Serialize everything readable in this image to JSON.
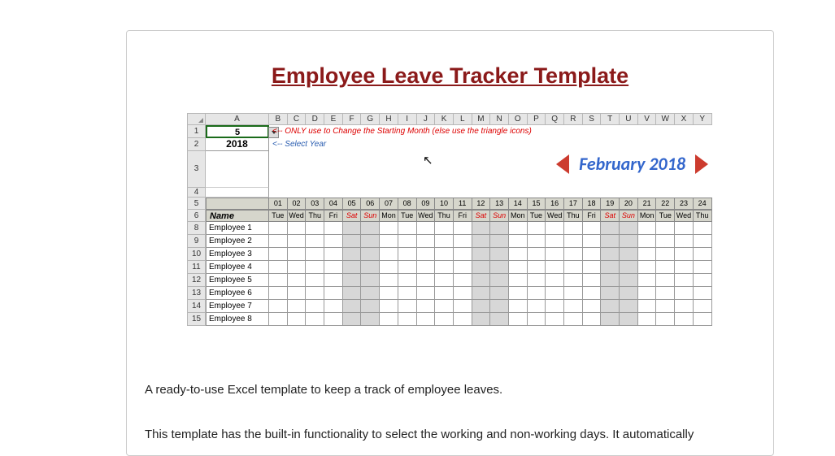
{
  "title": "Employee Leave Tracker Template",
  "columns": [
    "A",
    "B",
    "C",
    "D",
    "E",
    "F",
    "G",
    "H",
    "I",
    "J",
    "K",
    "L",
    "M",
    "N",
    "O",
    "P",
    "Q",
    "R",
    "S",
    "T",
    "U",
    "V",
    "W",
    "X",
    "Y"
  ],
  "row_labels": [
    "1",
    "2",
    "3",
    "4",
    "5",
    "6",
    "8",
    "9",
    "10",
    "11",
    "12",
    "13",
    "14",
    "15"
  ],
  "cellA1": "5",
  "cellA2": "2018",
  "note1": "<-- ONLY use to Change the Starting Month (else use the triangle icons)",
  "note2": "<-- Select Year",
  "month_label": "February 2018",
  "name_header": "Name",
  "days": {
    "nums": [
      "01",
      "02",
      "03",
      "04",
      "05",
      "06",
      "07",
      "08",
      "09",
      "10",
      "11",
      "12",
      "13",
      "14",
      "15",
      "16",
      "17",
      "18",
      "19",
      "20",
      "21",
      "22",
      "23",
      "24"
    ],
    "names": [
      "Tue",
      "Wed",
      "Thu",
      "Fri",
      "Sat",
      "Sun",
      "Mon",
      "Tue",
      "Wed",
      "Thu",
      "Fri",
      "Sat",
      "Sun",
      "Mon",
      "Tue",
      "Wed",
      "Thu",
      "Fri",
      "Sat",
      "Sun",
      "Mon",
      "Tue",
      "Wed",
      "Thu"
    ]
  },
  "weekend_idx": [
    4,
    5,
    11,
    12,
    18,
    19
  ],
  "employees": [
    "Employee 1",
    "Employee 2",
    "Employee 3",
    "Employee 4",
    "Employee 5",
    "Employee 6",
    "Employee 7",
    "Employee 8"
  ],
  "desc1": "A ready-to-use Excel template to keep a track of employee leaves.",
  "desc2": "This template has the built-in functionality to select the working and non-working days. It automatically"
}
